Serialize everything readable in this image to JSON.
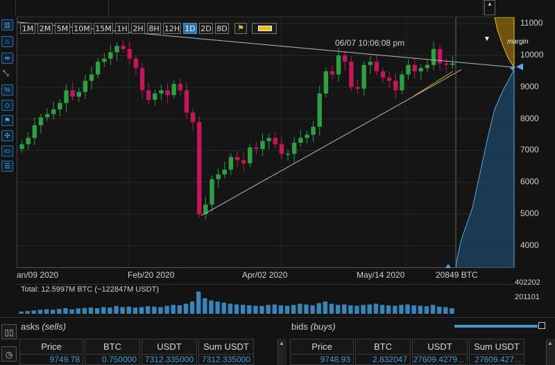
{
  "timeframes": [
    "1M",
    "2M",
    "5M",
    "10M",
    "15M",
    "1H",
    "2H",
    "8H",
    "12H",
    "1D",
    "2D",
    "8D"
  ],
  "active_timeframe": "1D",
  "crosshair_time": "06/07 10:06:08 pm",
  "margin_label": "margin",
  "chart_data": {
    "type": "candlestick",
    "y_ticks": [
      11000,
      10000,
      9000,
      8000,
      7000,
      6000,
      5000,
      4000
    ],
    "ylim": [
      3300,
      11200
    ],
    "x_tick_labels": [
      "an/09 2020",
      "Feb/20 2020",
      "Apr/02 2020",
      "May/14 2020"
    ],
    "x_cursor_label": "20849 BTC",
    "series": [
      {
        "name": "close",
        "values": [
          7200,
          7400,
          7800,
          8050,
          8150,
          8300,
          8500,
          8900,
          8700,
          8850,
          9200,
          9400,
          9800,
          9900,
          10100,
          10300,
          10200,
          9900,
          9600,
          8900,
          8600,
          8800,
          8900,
          8750,
          9100,
          8900,
          8200,
          7900,
          5000,
          5300,
          6100,
          6250,
          6400,
          6800,
          6700,
          6600,
          7100,
          7050,
          7300,
          7400,
          7200,
          6900,
          6900,
          7250,
          7400,
          7500,
          7750,
          8800,
          9500,
          9400,
          10000,
          9800,
          9000,
          8950,
          9700,
          9800,
          9500,
          9300,
          9200,
          8900,
          9400,
          9700,
          9500,
          9600,
          9700,
          10200,
          9750,
          9700,
          9750
        ]
      }
    ]
  },
  "volume": {
    "total_label": "Total: 12.5997M BTC (~122847M USDT)",
    "axis_top": "402202",
    "axis_mid": "201101",
    "bars": [
      0.1,
      0.12,
      0.15,
      0.18,
      0.2,
      0.18,
      0.22,
      0.25,
      0.2,
      0.24,
      0.26,
      0.28,
      0.25,
      0.3,
      0.28,
      0.35,
      0.3,
      0.32,
      0.28,
      0.3,
      0.34,
      0.32,
      0.3,
      0.36,
      0.4,
      0.38,
      0.45,
      0.55,
      1.0,
      0.7,
      0.6,
      0.55,
      0.5,
      0.45,
      0.42,
      0.4,
      0.38,
      0.36,
      0.35,
      0.4,
      0.42,
      0.38,
      0.36,
      0.4,
      0.45,
      0.42,
      0.38,
      0.48,
      0.55,
      0.45,
      0.4,
      0.42,
      0.38,
      0.36,
      0.4,
      0.42,
      0.45,
      0.4,
      0.38,
      0.36,
      0.4,
      0.42,
      0.38,
      0.36,
      0.34,
      0.4,
      0.32,
      0.3,
      0.25
    ]
  },
  "orderbook": {
    "asks_title": "asks",
    "asks_sub": "(sells)",
    "bids_title": "bids",
    "bids_sub": "(buys)",
    "columns": [
      "Price",
      "BTC",
      "USDT",
      "Sum USDT"
    ],
    "ask_row": [
      "9749.78",
      "0.750000",
      "7312.335000",
      "7312.335000"
    ],
    "bid_row": [
      "9748.93",
      "2.832047",
      "27609.4279...",
      "27609.427..."
    ]
  },
  "colors": {
    "up": "#2ea043",
    "down": "#c2185b",
    "accent": "#2d6fa8",
    "depth_bid": "#1e4a6b",
    "depth_ask": "#b8860b"
  }
}
